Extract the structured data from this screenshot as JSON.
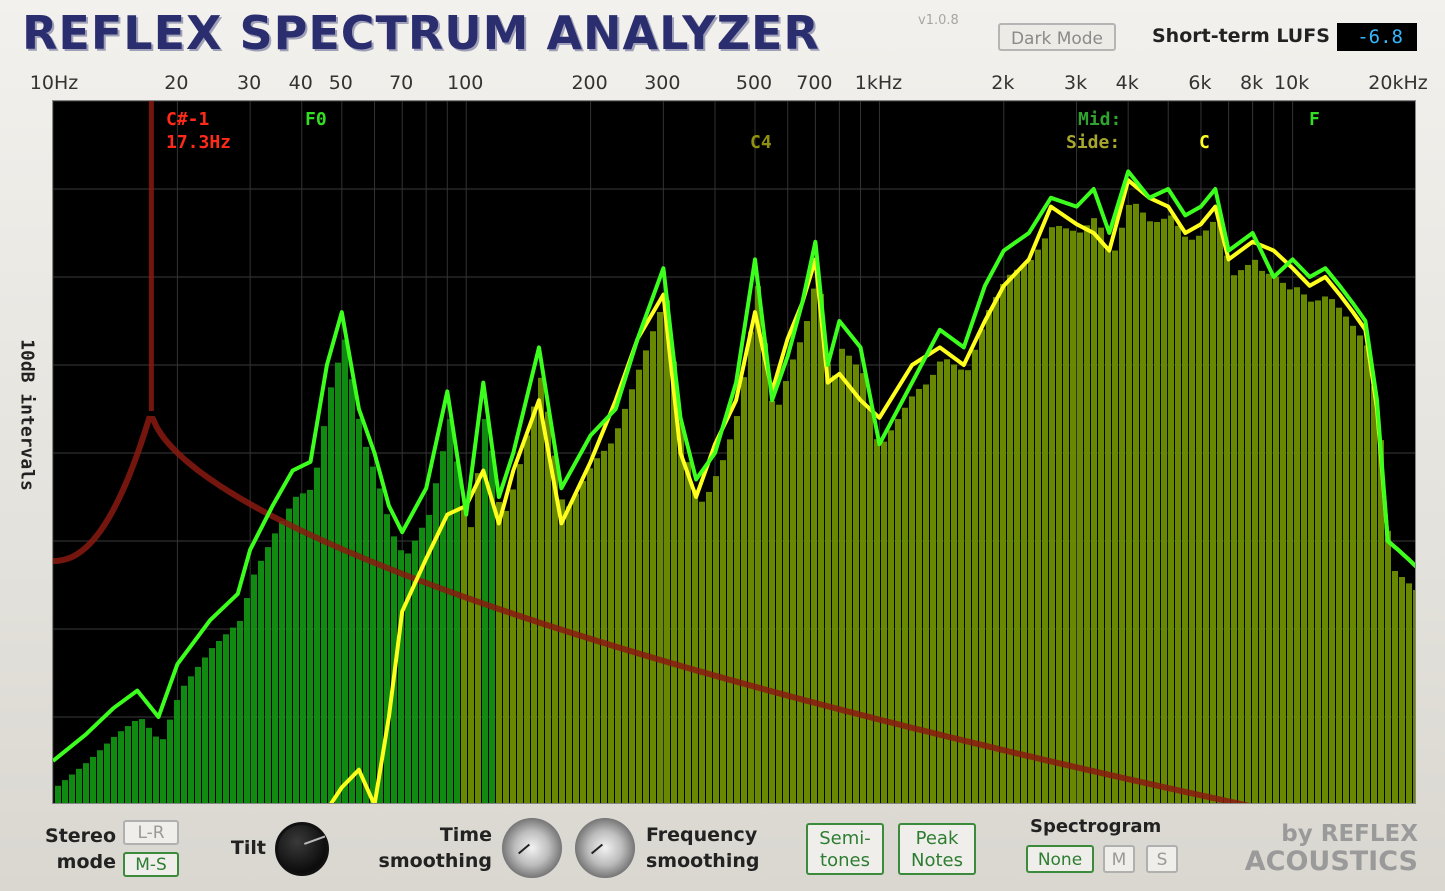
{
  "header": {
    "title": "REFLEX SPECTRUM ANALYZER",
    "version": "v1.0.8",
    "dark_mode_button": "Dark Mode",
    "lufs_label": "Short-term LUFS",
    "lufs_value": "-6.8"
  },
  "freq_axis": {
    "labels": [
      {
        "text": "10Hz",
        "freq": 10
      },
      {
        "text": "20",
        "freq": 20
      },
      {
        "text": "30",
        "freq": 30
      },
      {
        "text": "40",
        "freq": 40
      },
      {
        "text": "50",
        "freq": 50
      },
      {
        "text": "70",
        "freq": 70
      },
      {
        "text": "100",
        "freq": 100
      },
      {
        "text": "200",
        "freq": 200
      },
      {
        "text": "300",
        "freq": 300
      },
      {
        "text": "500",
        "freq": 500
      },
      {
        "text": "700",
        "freq": 700
      },
      {
        "text": "1kHz",
        "freq": 1000
      },
      {
        "text": "2k",
        "freq": 2000
      },
      {
        "text": "3k",
        "freq": 3000
      },
      {
        "text": "4k",
        "freq": 4000
      },
      {
        "text": "6k",
        "freq": 6000
      },
      {
        "text": "8k",
        "freq": 8000
      },
      {
        "text": "10k",
        "freq": 10000
      },
      {
        "text": "20kHz",
        "freq": 20000
      }
    ],
    "y_axis_label": "10dB intervals"
  },
  "notes": {
    "cursor_note": "C#-1",
    "cursor_freq": "17.3Hz",
    "low_peak_note": "F0",
    "mid_peak_note": "C4",
    "mid_label": "Mid:",
    "side_label": "Side:",
    "mid_note": "F",
    "side_note": "C"
  },
  "colors": {
    "mid_line": "#3cff1e",
    "side_line": "#ffff1e",
    "mid_bars": "#119111",
    "side_bars": "#6d8f00",
    "tilt_curve": "#8a1a10"
  },
  "controls": {
    "stereo_mode_label": "Stereo mode",
    "stereo_lr": "L-R",
    "stereo_ms": "M-S",
    "tilt_label": "Tilt",
    "time_smoothing_label": "Time smoothing",
    "frequency_smoothing_label": "Frequency smoothing",
    "semitones_button": "Semi- tones",
    "peak_notes_button": "Peak Notes",
    "spectrogram_label": "Spectrogram",
    "spectrogram_none": "None",
    "spectrogram_m": "M",
    "spectrogram_s": "S"
  },
  "brand": {
    "line1": "by REFLEX",
    "line2": "ACOUSTICS"
  },
  "chart_data": {
    "type": "area",
    "x_scale": "log",
    "xlim": [
      10,
      20000
    ],
    "ylabel": "10dB intervals",
    "x": [
      10,
      12,
      14,
      16,
      18,
      20,
      24,
      28,
      30,
      34,
      38,
      42,
      46,
      50,
      55,
      60,
      65,
      70,
      80,
      90,
      100,
      110,
      120,
      130,
      150,
      170,
      200,
      230,
      260,
      300,
      330,
      360,
      400,
      450,
      500,
      550,
      600,
      650,
      700,
      750,
      800,
      900,
      1000,
      1200,
      1400,
      1600,
      1800,
      2000,
      2300,
      2600,
      3000,
      3300,
      3600,
      4000,
      4500,
      5000,
      5500,
      6000,
      6500,
      7000,
      8000,
      9000,
      10000,
      11000,
      12000,
      13000,
      14000,
      15000,
      16000,
      17000,
      18000,
      19000,
      20000
    ],
    "series": [
      {
        "name": "Mid",
        "values": [
          -85,
          -82,
          -79,
          -77,
          -80,
          -74,
          -69,
          -66,
          -61,
          -56,
          -52,
          -51,
          -40,
          -34,
          -45,
          -50,
          -56,
          -59,
          -54,
          -43,
          -57,
          -42,
          -55,
          -50,
          -38,
          -54,
          -48,
          -45,
          -37,
          -29,
          -46,
          -53,
          -50,
          -42,
          -28,
          -44,
          -39,
          -33,
          -26,
          -40,
          -35,
          -38,
          -49,
          -42,
          -36,
          -38,
          -31,
          -27,
          -25,
          -21,
          -22,
          -20,
          -25,
          -18,
          -21,
          -20,
          -23,
          -22,
          -20,
          -27,
          -25,
          -30,
          -28,
          -30,
          -29,
          -31,
          -33,
          -35,
          -44,
          -60,
          -61,
          -62,
          -63
        ]
      },
      {
        "name": "Side",
        "values": [
          -95,
          -95,
          -95,
          -95,
          -95,
          -95,
          -95,
          -95,
          -95,
          -95,
          -95,
          -94,
          -92,
          -88,
          -86,
          -90,
          -80,
          -68,
          -62,
          -57,
          -56,
          -52,
          -58,
          -52,
          -44,
          -58,
          -51,
          -44,
          -37,
          -32,
          -50,
          -55,
          -49,
          -44,
          -34,
          -43,
          -37,
          -33,
          -28,
          -42,
          -41,
          -44,
          -46,
          -40,
          -38,
          -40,
          -35,
          -31,
          -28,
          -22,
          -24,
          -25,
          -27,
          -19,
          -21,
          -22,
          -25,
          -24,
          -22,
          -28,
          -26,
          -27,
          -29,
          -31,
          -30,
          -32,
          -34,
          -36,
          -45,
          -60,
          -61,
          -62,
          -63
        ]
      }
    ],
    "ylim": [
      -90,
      -10
    ]
  }
}
